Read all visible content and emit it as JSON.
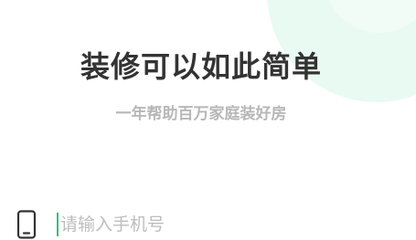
{
  "hero": {
    "title": "装修可以如此简单",
    "subtitle": "一年帮助百万家庭装好房"
  },
  "login": {
    "phone_placeholder": "请输入手机号",
    "phone_icon": "mobile-phone-icon"
  },
  "colors": {
    "accent": "#2fc27a",
    "decor": "#e9faf3",
    "title": "#333333",
    "subtitle": "#b7b7b7",
    "placeholder": "#bdbdbd"
  }
}
